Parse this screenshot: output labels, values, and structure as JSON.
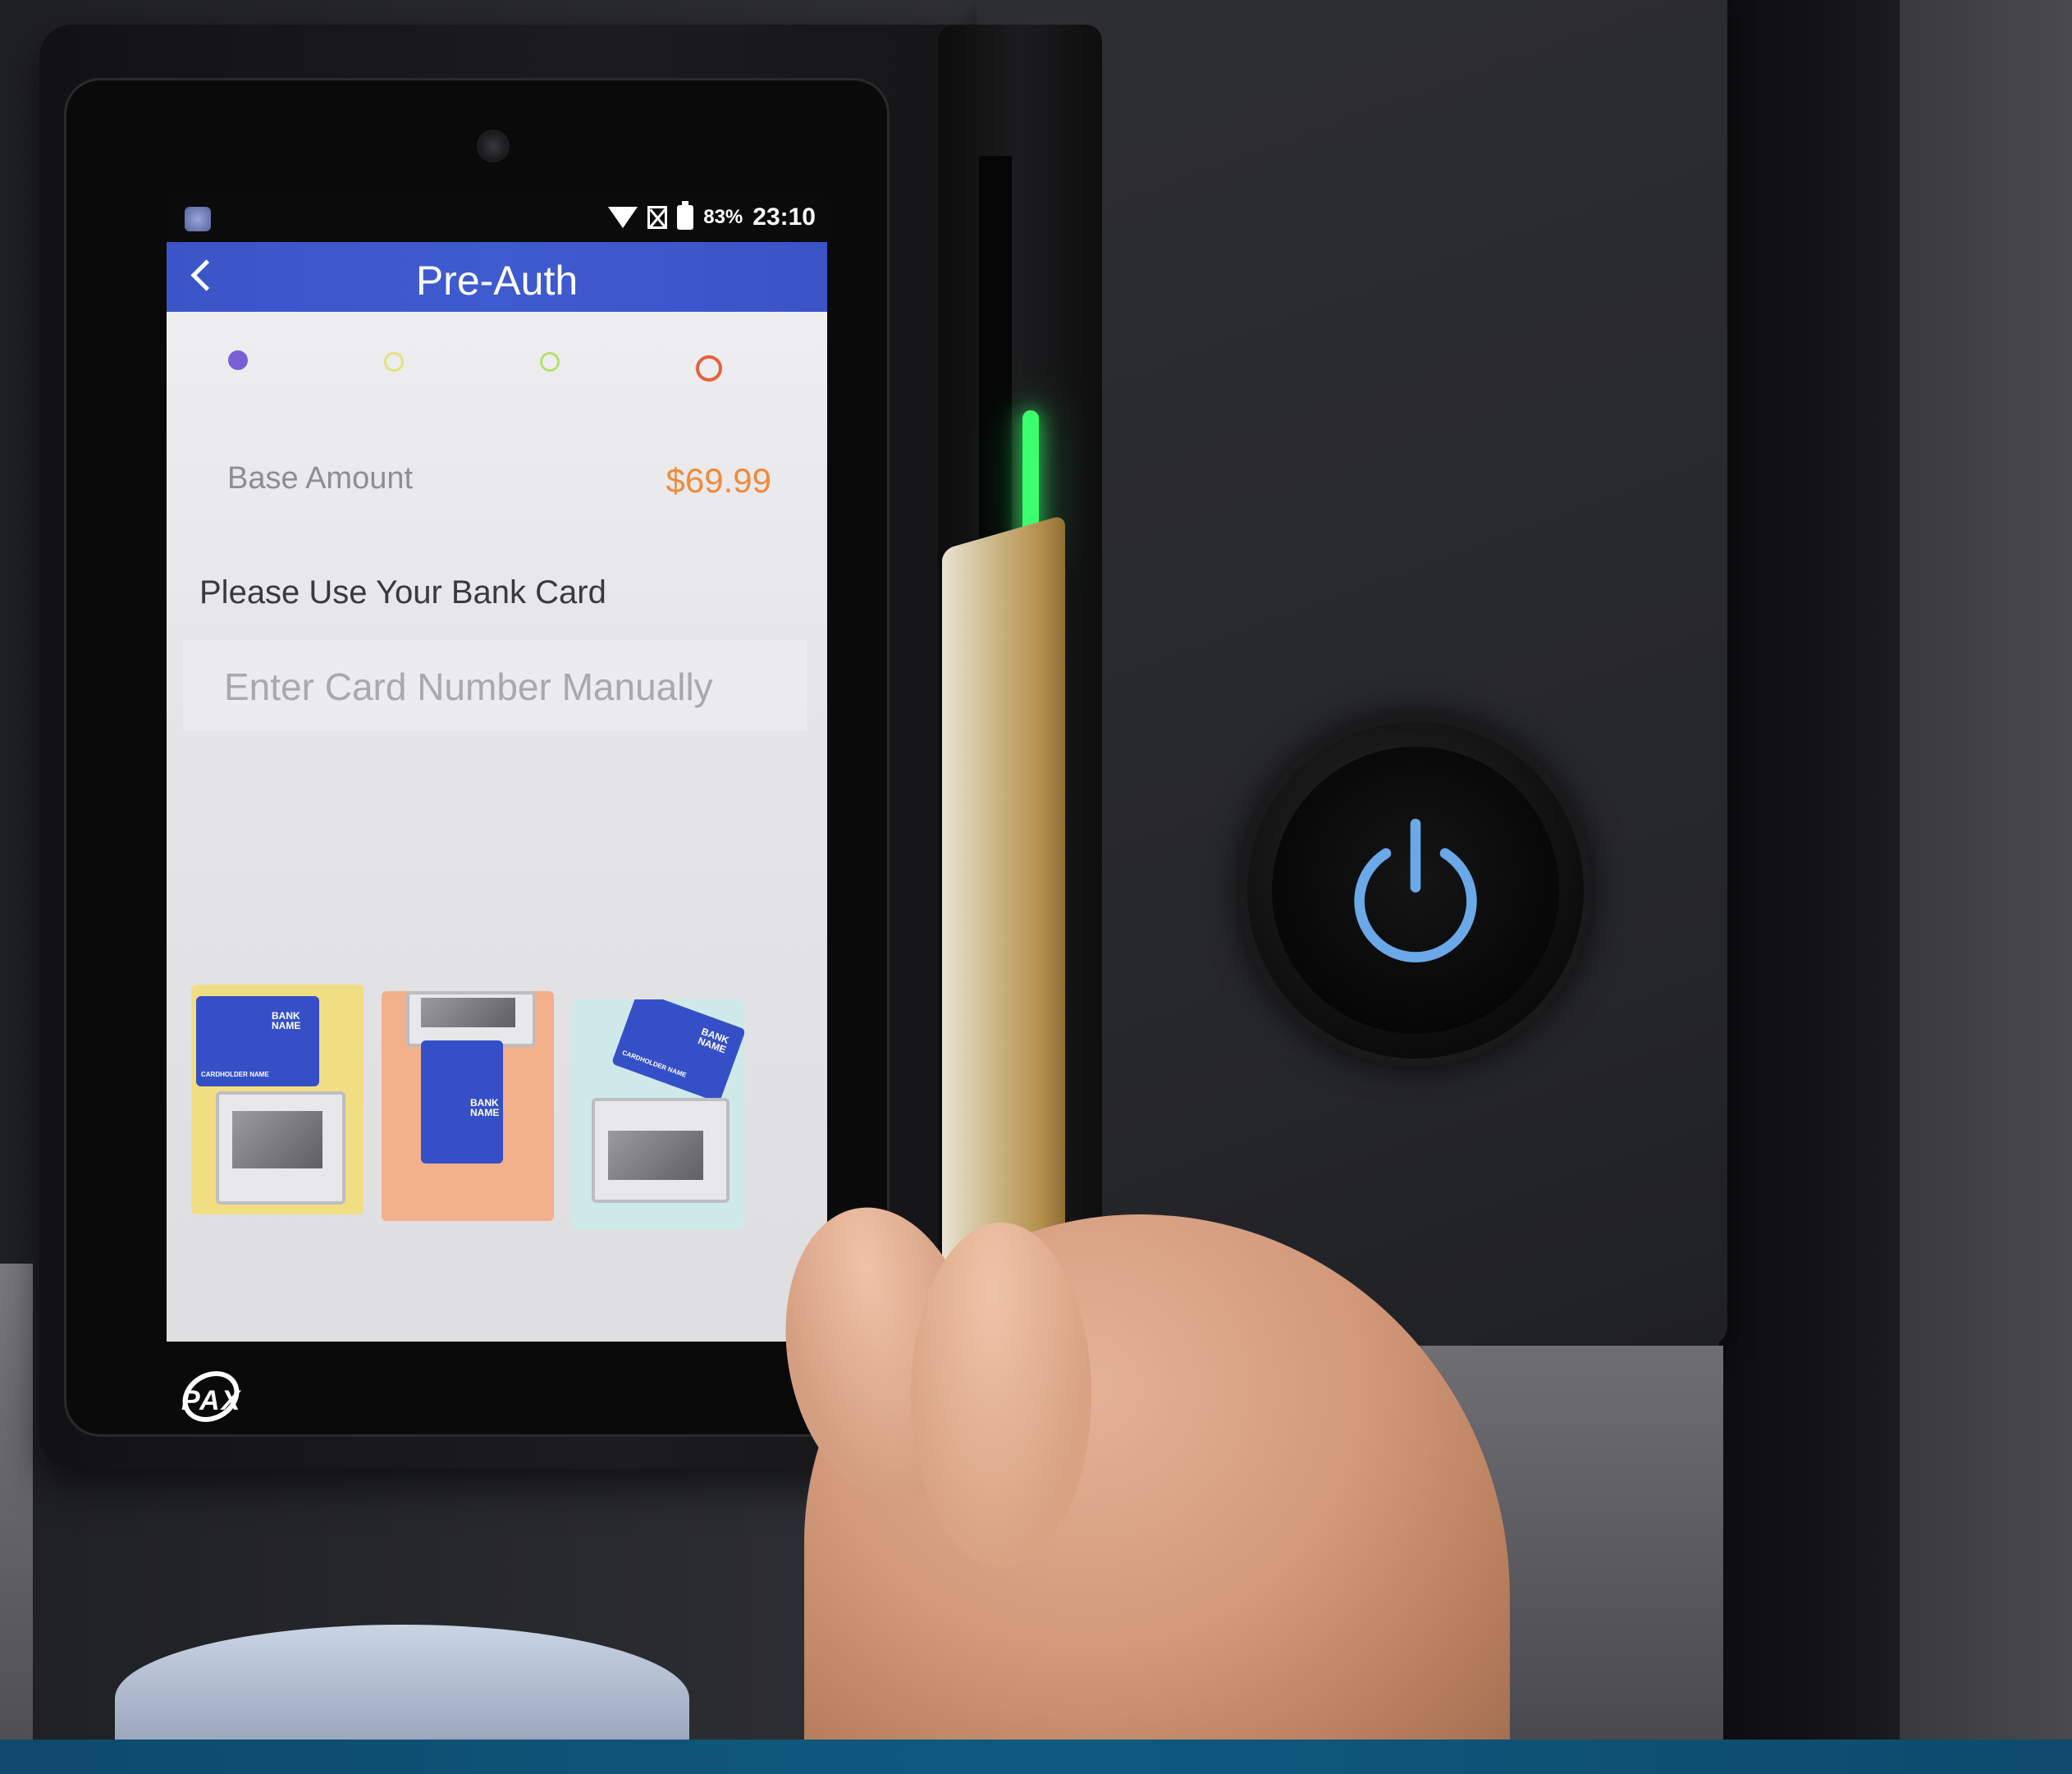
{
  "device": {
    "brand": "PAX"
  },
  "status_bar": {
    "icons": [
      "app-icon",
      "wifi-icon",
      "no-sim-icon",
      "battery-icon"
    ],
    "battery": "83%",
    "time": "23:10"
  },
  "app_bar": {
    "back_icon": "chevron-left-icon",
    "title": "Pre-Auth"
  },
  "progress": {
    "current_step": 1,
    "total_steps": 4,
    "colors": [
      "#7a5fd6",
      "#e3e37d",
      "#b6e06c",
      "#e8603c"
    ]
  },
  "amount": {
    "label": "Base Amount",
    "value": "$69.99"
  },
  "prompt": "Please Use Your Bank Card",
  "manual_entry": {
    "label": "Enter Card Number Manually"
  },
  "payment_methods": [
    {
      "name": "swipe",
      "card_text": "BANK NAME",
      "holder_text": "CARDHOLDER NAME",
      "color": "#f2de82"
    },
    {
      "name": "insert",
      "card_text": "BANK NAME",
      "color": "#f2b08b"
    },
    {
      "name": "tap",
      "card_text": "BANK NAME",
      "holder_text": "CARDHOLDER NAME",
      "color": "#cfe9ea"
    }
  ],
  "colors": {
    "app_bar": "#3f5bd0",
    "amount": "#f08a3a",
    "power_ring": "#6aa8e8"
  }
}
